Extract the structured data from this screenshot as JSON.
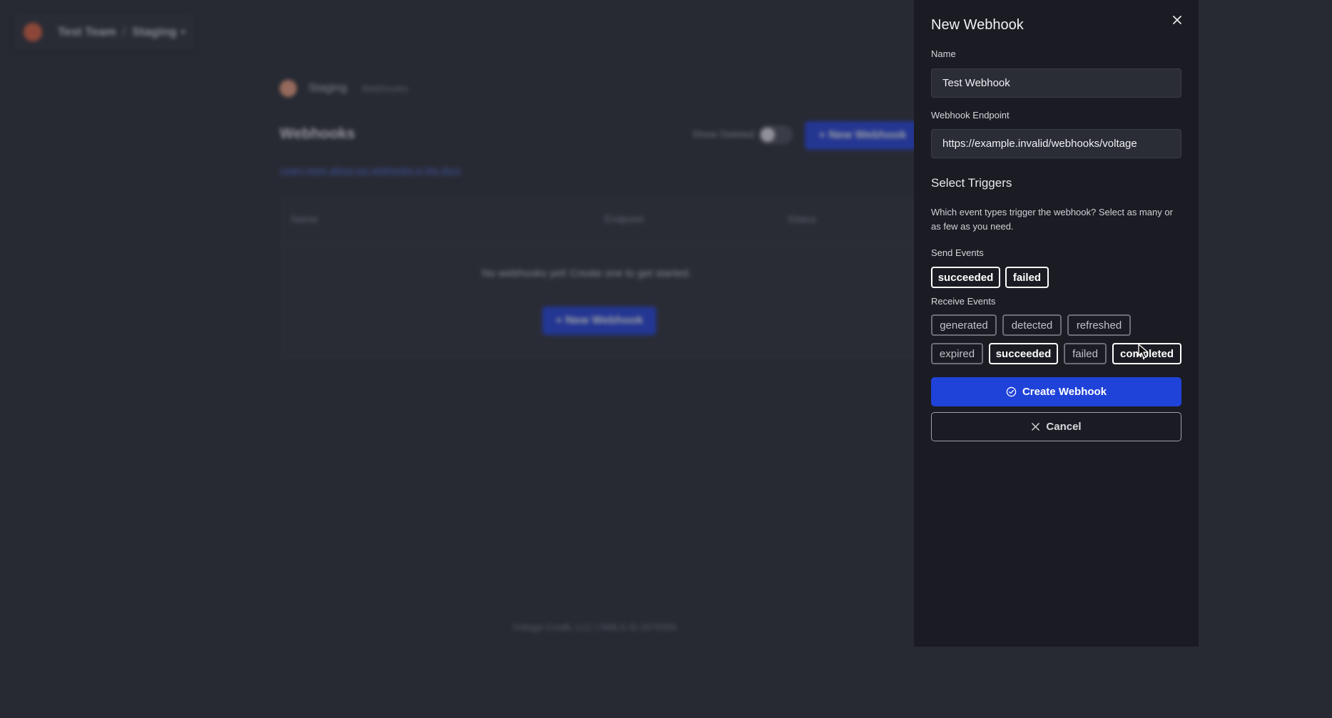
{
  "background": {
    "team_switcher": {
      "team": "Test Team",
      "separator": "/",
      "environment": "Staging"
    },
    "breadcrumb": {
      "parent": "Staging",
      "current": "Webhooks"
    },
    "page_title": "Webhooks",
    "show_deleted_label": "Show Deleted",
    "new_webhook_label": "+ New Webhook",
    "learn_more_link": "Learn more about our webhooks in the docs",
    "table_headers": [
      "Name",
      "Endpoint",
      "Status"
    ],
    "empty_message": "No webhooks yet! Create one to get started.",
    "footer": "Voltage Credit, LLC | NMLS ID 2079356"
  },
  "panel": {
    "title": "New Webhook",
    "name_label": "Name",
    "name_value": "Test Webhook",
    "endpoint_label": "Webhook Endpoint",
    "endpoint_value": "https://example.invalid/webhooks/voltage",
    "triggers_title": "Select Triggers",
    "triggers_help": "Which event types trigger the webhook? Select as many or as few as you need.",
    "send_events_label": "Send Events",
    "send_events": [
      {
        "label": "succeeded",
        "selected": true
      },
      {
        "label": "failed",
        "selected": true
      }
    ],
    "receive_events_label": "Receive Events",
    "receive_events": [
      {
        "label": "generated",
        "selected": false
      },
      {
        "label": "detected",
        "selected": false
      },
      {
        "label": "refreshed",
        "selected": false
      },
      {
        "label": "expired",
        "selected": false
      },
      {
        "label": "succeeded",
        "selected": true
      },
      {
        "label": "failed",
        "selected": false
      },
      {
        "label": "completed",
        "selected": true
      }
    ],
    "create_label": "Create Webhook",
    "cancel_label": "Cancel"
  },
  "colors": {
    "accent": "#1f42d8",
    "panel_bg": "#1b1c23",
    "page_bg": "#282a33"
  },
  "icons": [
    "close-icon",
    "check-circle-icon",
    "x-icon",
    "mouse-cursor-icon"
  ]
}
